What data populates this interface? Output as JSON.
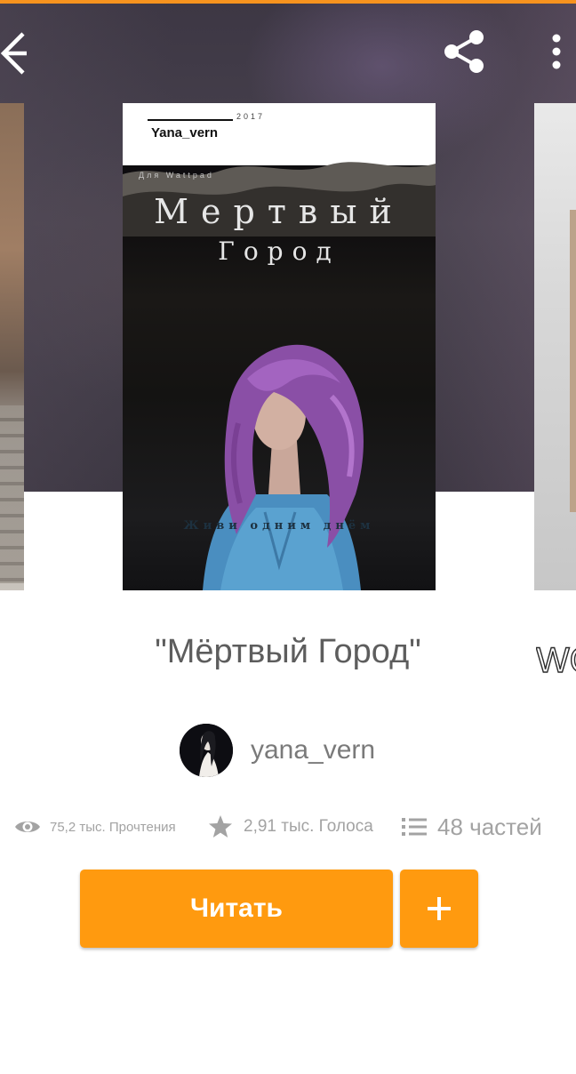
{
  "colors": {
    "accent": "#ff9a0f",
    "top_accent": "#f7931e",
    "title_text": "#5d5d5d",
    "muted_text": "#a3a3a3"
  },
  "toolbar": {
    "back_icon": "arrow-left-icon",
    "share_icon": "share-icon",
    "more_icon": "more-vertical-icon"
  },
  "cover": {
    "author": "Yana_vern",
    "year": "2017",
    "small_caption": "Для Wattpad",
    "title_line1": "Мертвый",
    "title_line2": "Город",
    "tagline": "Живи одним днём"
  },
  "story": {
    "title": "\"Мёртвый Город\"",
    "author": "yana_vern"
  },
  "stats": {
    "reads": "75,2 тыс. Прочтения",
    "votes": "2,91 тыс. Голоса",
    "parts": "48 частей",
    "reads_icon": "eye-icon",
    "votes_icon": "star-icon",
    "parts_icon": "list-icon"
  },
  "actions": {
    "read_label": "Читать",
    "add_icon": "plus-icon"
  },
  "side_covers": {
    "right_text": "WO"
  }
}
